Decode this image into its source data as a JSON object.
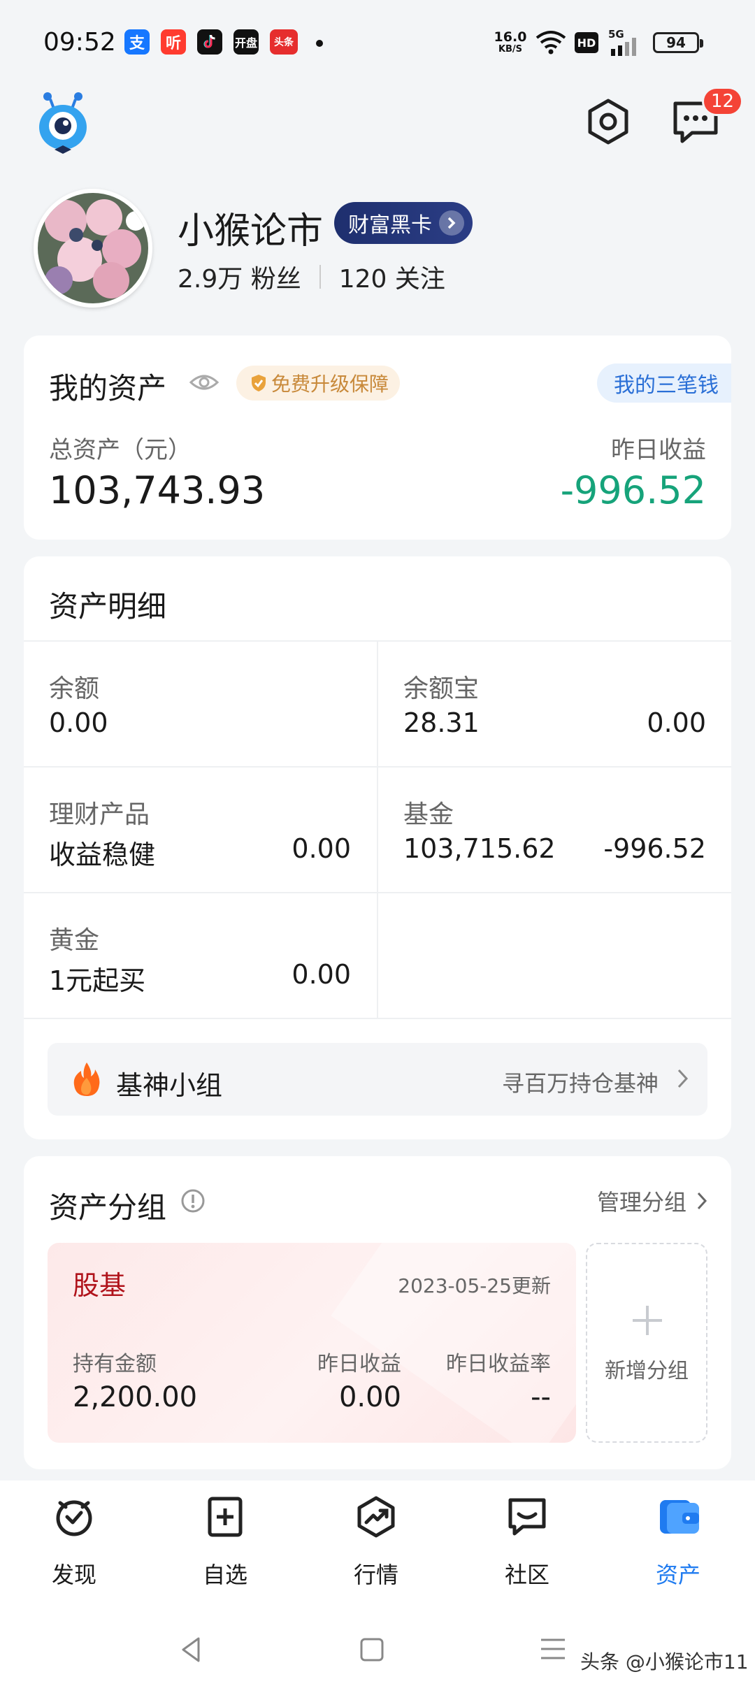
{
  "status_bar": {
    "time": "09:52",
    "app_icons": [
      "alipay-icon",
      "ting-icon",
      "tiktok-icon",
      "kaipan-icon",
      "toutiao-icon"
    ],
    "app_labels": {
      "alipay": "支",
      "ting": "听",
      "kaipan": "开盘",
      "toutiao": "头条"
    },
    "net_speed": "16.0",
    "net_speed_unit": "KB/S",
    "hd": "HD",
    "network": "5G",
    "battery": "94"
  },
  "header": {
    "message_badge": "12"
  },
  "profile": {
    "name": "小猴论市",
    "vip_label": "财富黑卡",
    "fans": "2.9万 粉丝",
    "following": "120 关注"
  },
  "my_assets": {
    "title": "我的资产",
    "upgrade_badge": "免费升级保障",
    "three_money": "我的三笔钱",
    "total_label": "总资产（元）",
    "total_value": "103,743.93",
    "yesterday_label": "昨日收益",
    "yesterday_value": "-996.52"
  },
  "asset_detail": {
    "title": "资产明细",
    "cells": [
      {
        "label": "余额",
        "sub": "0.00",
        "value": ""
      },
      {
        "label": "余额宝",
        "sub": "28.31",
        "value": "0.00"
      },
      {
        "label": "理财产品",
        "sub": "收益稳健",
        "value": "0.00"
      },
      {
        "label": "基金",
        "sub": "103,715.62",
        "value": "-996.52"
      },
      {
        "label": "黄金",
        "sub": "1元起买",
        "value": "0.00"
      }
    ],
    "god_group": {
      "label": "基神小组",
      "hint": "寻百万持仓基神"
    }
  },
  "asset_groups": {
    "title": "资产分组",
    "manage": "管理分组",
    "group": {
      "name": "股基",
      "updated": "2023-05-25更新",
      "holding_label": "持有金额",
      "holding_value": "2,200.00",
      "yesterday_label": "昨日收益",
      "yesterday_value": "0.00",
      "rate_label": "昨日收益率",
      "rate_value": "--"
    },
    "add_group": "新增分组"
  },
  "bottom_nav": [
    {
      "label": "发现",
      "icon": "discover-icon"
    },
    {
      "label": "自选",
      "icon": "watchlist-icon"
    },
    {
      "label": "行情",
      "icon": "market-icon"
    },
    {
      "label": "社区",
      "icon": "community-icon"
    },
    {
      "label": "资产",
      "icon": "wallet-icon",
      "active": true
    }
  ],
  "watermark": "头条 @小猴论市11",
  "colors": {
    "accent_blue": "#1f7bf0",
    "loss_green": "#16a37a",
    "vip_navy": "#1e2f6e",
    "badge_red": "#f44336",
    "group_name_red": "#b0131b"
  }
}
